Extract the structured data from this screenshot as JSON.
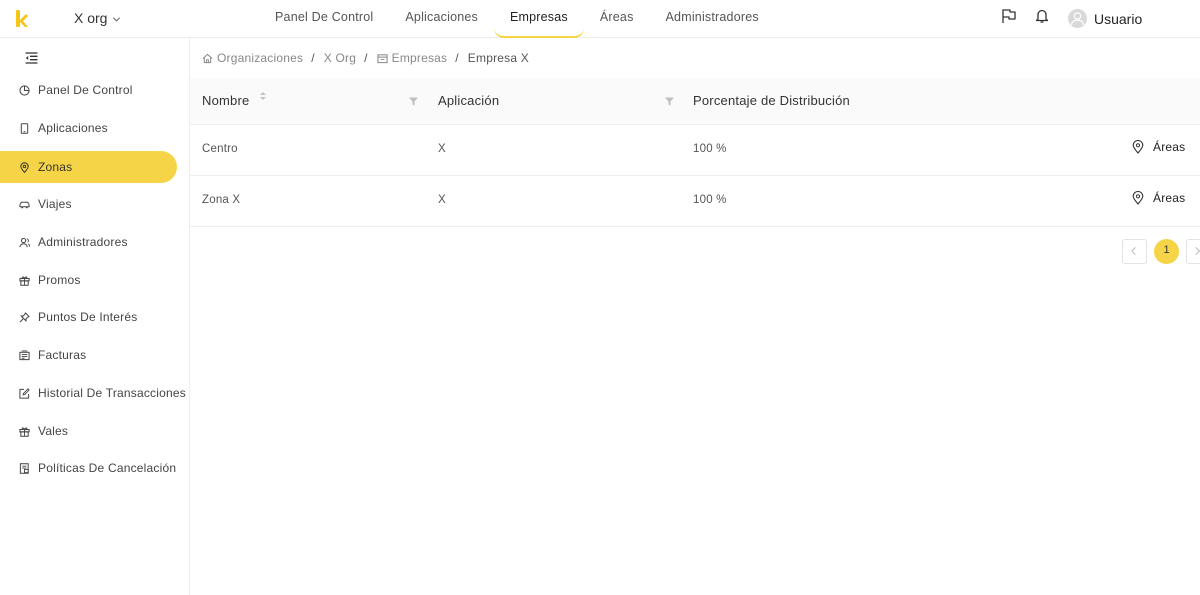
{
  "topbar": {
    "org_name": "X org",
    "nav": [
      "Panel De Control",
      "Aplicaciones",
      "Empresas",
      "Áreas",
      "Administradores"
    ],
    "active_nav": "Empresas",
    "user_name": "Usuario"
  },
  "sidebar": {
    "items": [
      {
        "label": "Panel De Control",
        "icon": "pie-chart-icon"
      },
      {
        "label": "Aplicaciones",
        "icon": "phone-icon"
      },
      {
        "label": "Zonas",
        "icon": "location-pin-icon"
      },
      {
        "label": "Viajes",
        "icon": "car-icon"
      },
      {
        "label": "Administradores",
        "icon": "users-icon"
      },
      {
        "label": "Promos",
        "icon": "gift-icon"
      },
      {
        "label": "Puntos De Interés",
        "icon": "pin-icon"
      },
      {
        "label": "Facturas",
        "icon": "invoice-icon"
      },
      {
        "label": "Historial De Transacciones",
        "icon": "edit-icon"
      },
      {
        "label": "Vales",
        "icon": "gift-icon"
      },
      {
        "label": "Políticas De Cancelación",
        "icon": "policy-icon"
      }
    ],
    "active_item": "Zonas"
  },
  "breadcrumb": {
    "items": [
      "Organizaciones",
      "X Org",
      "Empresas",
      "Empresa X"
    ]
  },
  "table": {
    "columns": [
      "Nombre",
      "Aplicación",
      "Porcentaje de Distribución"
    ],
    "rows": [
      {
        "nombre": "Centro",
        "aplicacion": "X",
        "porcentaje": "100 %",
        "action": "Áreas"
      },
      {
        "nombre": "Zona X",
        "aplicacion": "X",
        "porcentaje": "100 %",
        "action": "Áreas"
      }
    ]
  },
  "pagination": {
    "current_page": "1"
  },
  "colors": {
    "accent": "#f5d547",
    "border": "#eeeeee",
    "header_bg": "#fafafa"
  }
}
